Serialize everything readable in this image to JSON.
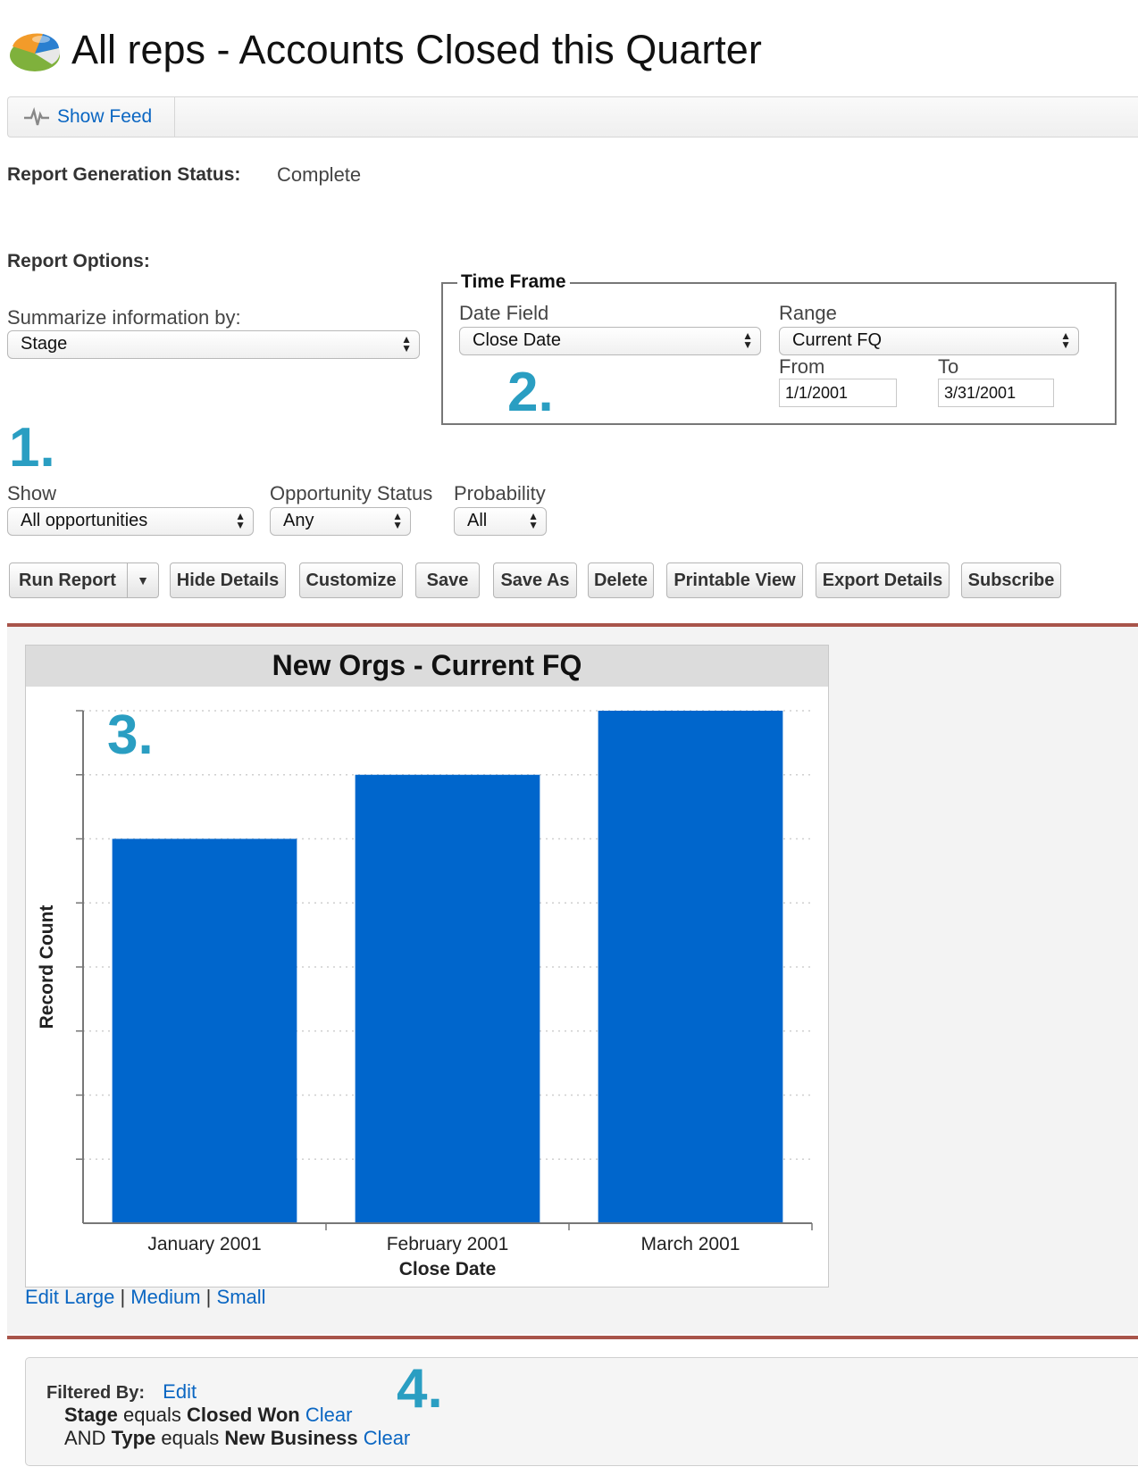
{
  "header": {
    "title": "All reps - Accounts Closed this Quarter",
    "feed_label": "Show Feed"
  },
  "status": {
    "label": "Report Generation Status:",
    "value": "Complete"
  },
  "options": {
    "heading": "Report Options:",
    "summarize_label": "Summarize information by:",
    "summarize_value": "Stage",
    "timeframe": {
      "legend": "Time Frame",
      "date_field_label": "Date Field",
      "date_field_value": "Close Date",
      "range_label": "Range",
      "range_value": "Current FQ",
      "from_label": "From",
      "from_value": "1/1/2001",
      "to_label": "To",
      "to_value": "3/31/2001"
    },
    "show_label": "Show",
    "show_value": "All opportunities",
    "opp_status_label": "Opportunity Status",
    "opp_status_value": "Any",
    "probability_label": "Probability",
    "probability_value": "All"
  },
  "annotations": [
    "1.",
    "2.",
    "3.",
    "4."
  ],
  "toolbar": {
    "run_report": "Run Report",
    "hide_details": "Hide Details",
    "customize": "Customize",
    "save": "Save",
    "save_as": "Save As",
    "delete": "Delete",
    "printable_view": "Printable View",
    "export_details": "Export Details",
    "subscribe": "Subscribe"
  },
  "chart_links": {
    "edit": "Edit",
    "large": "Large",
    "medium": "Medium",
    "small": "Small",
    "sep": "|"
  },
  "chart_data": {
    "type": "bar",
    "title": "New Orgs - Current FQ",
    "xlabel": "Close Date",
    "ylabel": "Record Count",
    "categories": [
      "January 2001",
      "February 2001",
      "March 2001"
    ],
    "values": [
      6,
      7,
      8
    ],
    "ylim": [
      0,
      8
    ],
    "grid": true,
    "bar_color": "#0066cc"
  },
  "filters": {
    "label": "Filtered By:",
    "edit": "Edit",
    "clear": "Clear",
    "f1_field": "Stage",
    "f1_op": "equals",
    "f1_value": "Closed Won",
    "f2_prefix": "AND",
    "f2_field": "Type",
    "f2_op": "equals",
    "f2_value": "New Business"
  },
  "colors": {
    "link": "#0a66c2",
    "annotation": "#2a9ec2",
    "rule": "#a8544a"
  }
}
